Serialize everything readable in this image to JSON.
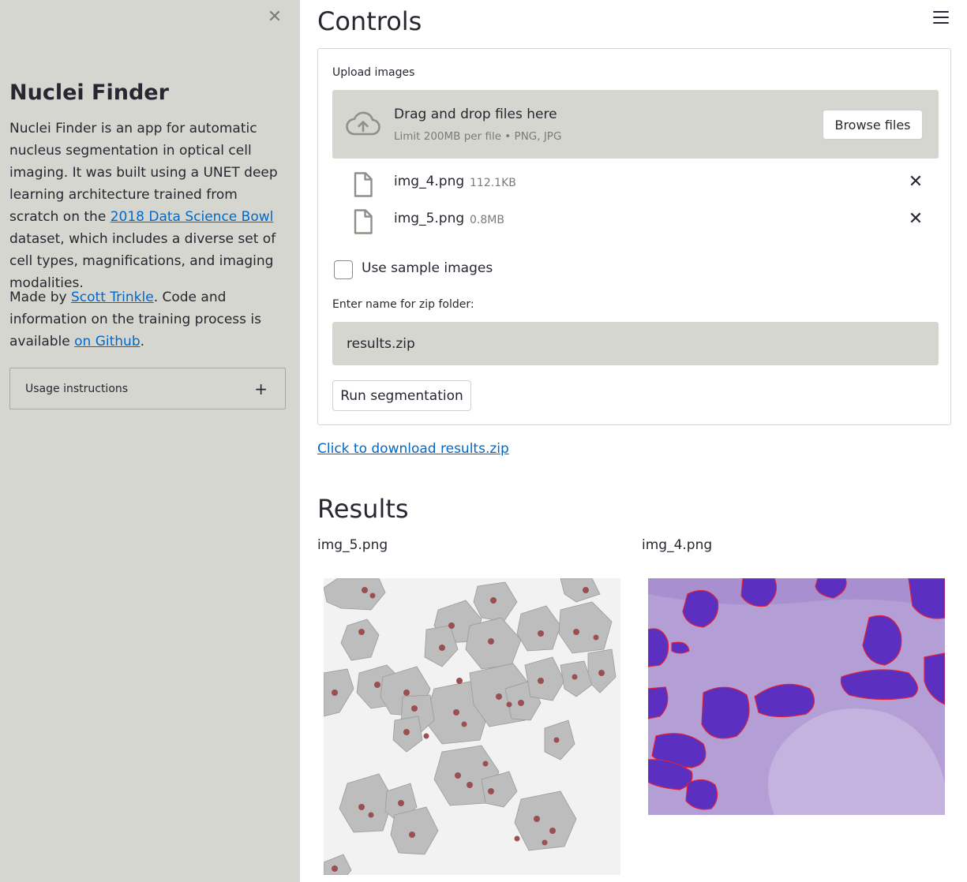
{
  "sidebar": {
    "close_icon": "close-icon",
    "title": "Nuclei Finder",
    "desc_part1": "Nuclei Finder is an app for automatic nucleus segmentation in optical cell imaging. It was built using a UNET deep learning architecture trained from scratch on the ",
    "desc_link": "2018 Data Science Bowl",
    "desc_part2": " dataset, which includes a diverse set of cell types, magnifications, and imaging modalities.",
    "credit_part1": "Made by ",
    "credit_link": "Scott Trinkle",
    "credit_part2": ". Code and information on the training process is available ",
    "credit_link2": "on Github",
    "credit_part3": ".",
    "expander_label": "Usage instructions",
    "expander_icon": "+"
  },
  "main": {
    "controls_title": "Controls",
    "upload_label": "Upload images",
    "dropzone_title": "Drag and drop files here",
    "dropzone_sub": "Limit 200MB per file • PNG, JPG",
    "browse_label": "Browse files",
    "files": [
      {
        "name": "img_4.png",
        "size": "112.1KB"
      },
      {
        "name": "img_5.png",
        "size": "0.8MB"
      }
    ],
    "sample_checkbox_label": "Use sample images",
    "sample_checkbox_checked": false,
    "zip_label": "Enter name for zip folder:",
    "zip_value": "results.zip",
    "run_label": "Run segmentation",
    "download_link": "Click to download results.zip",
    "results_title": "Results",
    "results": [
      {
        "caption": "img_5.png"
      },
      {
        "caption": "img_4.png"
      }
    ]
  },
  "colors": {
    "sidebar_bg": "#d6d6d0",
    "link": "#0068c9",
    "text": "#262730",
    "nucleus_outline": "#e0203a",
    "purple_stain": "#5b2fc0"
  }
}
